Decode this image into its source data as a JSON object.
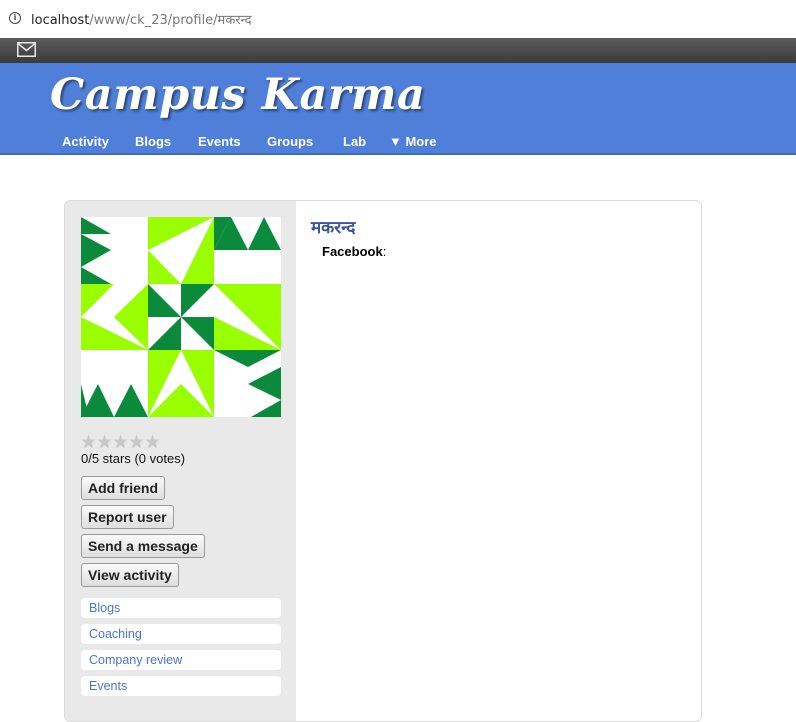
{
  "browser": {
    "url_host": "localhost",
    "url_path": "/www/ck_23/profile/मकरन्द"
  },
  "icons": {
    "info": "info-icon",
    "mail": "mail-icon",
    "star": "star-icon"
  },
  "site": {
    "title": "Campus Karma",
    "nav": [
      {
        "label": "Activity"
      },
      {
        "label": "Blogs"
      },
      {
        "label": "Events"
      },
      {
        "label": "Groups"
      },
      {
        "label": "Lab"
      },
      {
        "label": "▼ More"
      }
    ]
  },
  "profile": {
    "name": "मकरन्द",
    "facebook_label": "Facebook",
    "facebook_sep": ":",
    "rating_text": "0/5 stars (0 votes)",
    "rating_value": 0,
    "rating_max": 5
  },
  "actions": [
    {
      "label": "Add friend"
    },
    {
      "label": "Report user"
    },
    {
      "label": "Send a message"
    },
    {
      "label": "View activity"
    }
  ],
  "side_links": [
    {
      "label": "Blogs"
    },
    {
      "label": "Coaching"
    },
    {
      "label": "Company review"
    },
    {
      "label": "Events"
    }
  ],
  "colors": {
    "header_blue": "#4f7fd8",
    "identicon_dark": "#0a8a3a",
    "identicon_light": "#99ff00",
    "link_blue": "#4a76c9",
    "name_blue": "#3b55a3"
  }
}
